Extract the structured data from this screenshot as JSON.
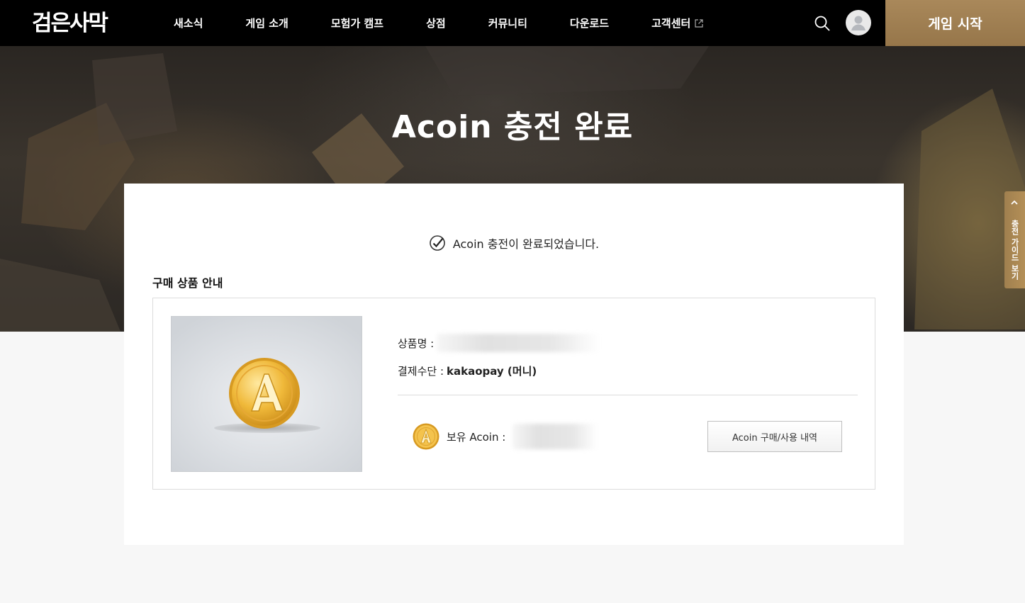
{
  "header": {
    "logo_text": "검은사막",
    "nav": [
      {
        "label": "새소식"
      },
      {
        "label": "게임 소개"
      },
      {
        "label": "모험가 캠프"
      },
      {
        "label": "상점"
      },
      {
        "label": "커뮤니티"
      },
      {
        "label": "다운로드"
      },
      {
        "label": "고객센터",
        "external": true
      }
    ],
    "start_button": "게임 시작",
    "icons": {
      "search": "search-icon",
      "avatar": "user-avatar-icon",
      "external": "external-link-icon"
    }
  },
  "hero": {
    "title": "Acoin 충전 완료",
    "guide_tab": "충전 가이드 보기"
  },
  "main": {
    "done_message": "Acoin 충전이 완료되었습니다.",
    "section_title": "구매 상품 안내",
    "product_name_label": "상품명 :",
    "payment_label": "결제수단 :",
    "payment_value": "kakaopay (머니)",
    "holding_label": "보유 Acoin :",
    "history_button": "Acoin 구매/사용 내역"
  },
  "colors": {
    "header_bg": "#000000",
    "start_button": "#a08053",
    "coin_gold": "#e3a92b",
    "page_bg": "#f7f7f7"
  }
}
